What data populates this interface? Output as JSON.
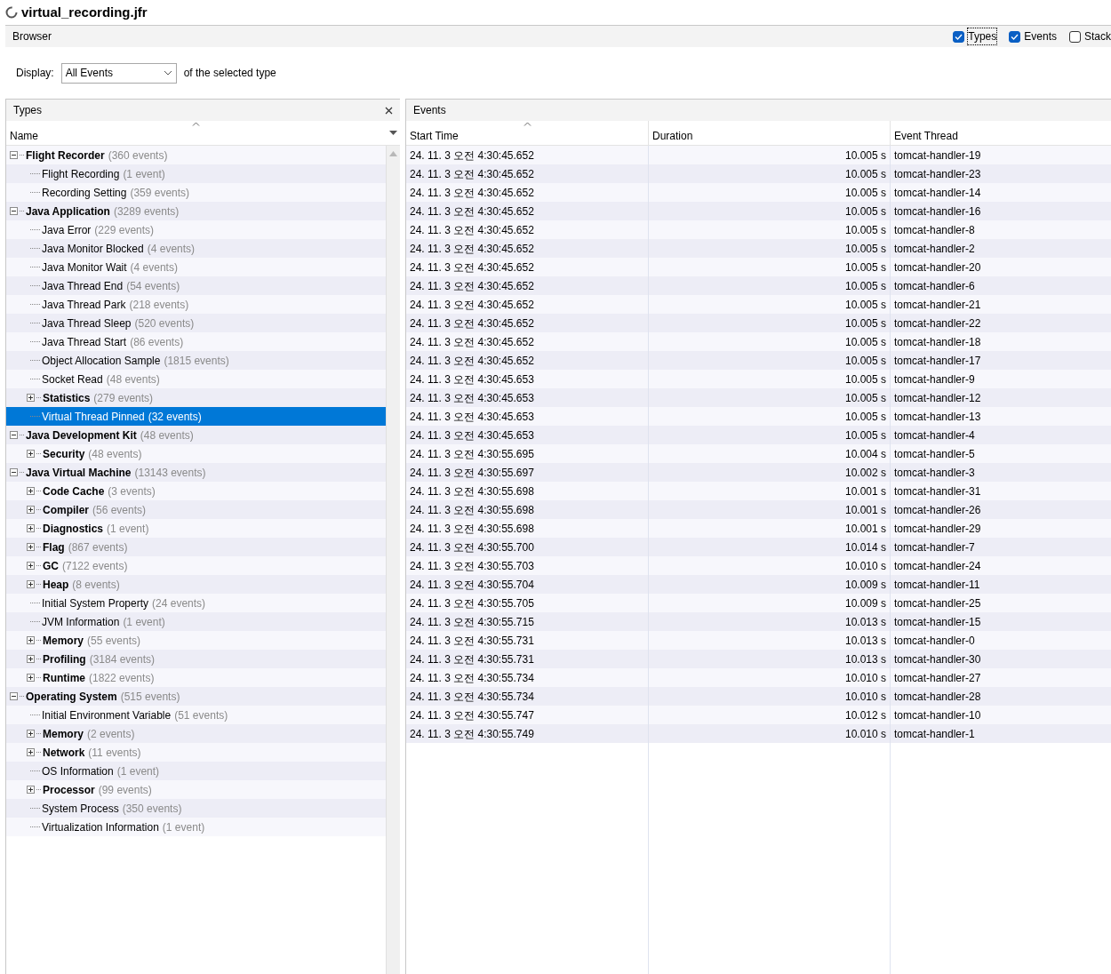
{
  "window": {
    "title": "virtual_recording.jfr"
  },
  "toolbar": {
    "title": "Browser",
    "toggles": [
      {
        "label": "Types",
        "checked": true,
        "focused": true
      },
      {
        "label": "Events",
        "checked": true,
        "focused": false
      },
      {
        "label": "Stack",
        "checked": false,
        "focused": false
      }
    ]
  },
  "display": {
    "label": "Display:",
    "value": "All Events",
    "suffix": "of the selected type"
  },
  "types_panel": {
    "title": "Types",
    "column": "Name",
    "tree": [
      {
        "name": "Flight Recorder",
        "count": "(360 events)",
        "kind": "group",
        "expanded": true,
        "selected": false,
        "children": [
          {
            "name": "Flight Recording",
            "count": "(1 event)",
            "kind": "leaf",
            "selected": false
          },
          {
            "name": "Recording Setting",
            "count": "(359 events)",
            "kind": "leaf",
            "selected": false
          }
        ]
      },
      {
        "name": "Java Application",
        "count": "(3289 events)",
        "kind": "group",
        "expanded": true,
        "selected": false,
        "children": [
          {
            "name": "Java Error",
            "count": "(229 events)",
            "kind": "leaf",
            "selected": false
          },
          {
            "name": "Java Monitor Blocked",
            "count": "(4 events)",
            "kind": "leaf",
            "selected": false
          },
          {
            "name": "Java Monitor Wait",
            "count": "(4 events)",
            "kind": "leaf",
            "selected": false
          },
          {
            "name": "Java Thread End",
            "count": "(54 events)",
            "kind": "leaf",
            "selected": false
          },
          {
            "name": "Java Thread Park",
            "count": "(218 events)",
            "kind": "leaf",
            "selected": false
          },
          {
            "name": "Java Thread Sleep",
            "count": "(520 events)",
            "kind": "leaf",
            "selected": false
          },
          {
            "name": "Java Thread Start",
            "count": "(86 events)",
            "kind": "leaf",
            "selected": false
          },
          {
            "name": "Object Allocation Sample",
            "count": "(1815 events)",
            "kind": "leaf",
            "selected": false
          },
          {
            "name": "Socket Read",
            "count": "(48 events)",
            "kind": "leaf",
            "selected": false
          },
          {
            "name": "Statistics",
            "count": "(279 events)",
            "kind": "group",
            "expanded": false,
            "selected": false
          },
          {
            "name": "Virtual Thread Pinned",
            "count": "(32 events)",
            "kind": "leaf",
            "selected": true
          }
        ]
      },
      {
        "name": "Java Development Kit",
        "count": "(48 events)",
        "kind": "group",
        "expanded": true,
        "selected": false,
        "children": [
          {
            "name": "Security",
            "count": "(48 events)",
            "kind": "group",
            "expanded": false,
            "selected": false
          }
        ]
      },
      {
        "name": "Java Virtual Machine",
        "count": "(13143 events)",
        "kind": "group",
        "expanded": true,
        "selected": false,
        "children": [
          {
            "name": "Code Cache",
            "count": "(3 events)",
            "kind": "group",
            "expanded": false,
            "selected": false
          },
          {
            "name": "Compiler",
            "count": "(56 events)",
            "kind": "group",
            "expanded": false,
            "selected": false
          },
          {
            "name": "Diagnostics",
            "count": "(1 event)",
            "kind": "group",
            "expanded": false,
            "selected": false
          },
          {
            "name": "Flag",
            "count": "(867 events)",
            "kind": "group",
            "expanded": false,
            "selected": false
          },
          {
            "name": "GC",
            "count": "(7122 events)",
            "kind": "group",
            "expanded": false,
            "selected": false
          },
          {
            "name": "Heap",
            "count": "(8 events)",
            "kind": "group",
            "expanded": false,
            "selected": false
          },
          {
            "name": "Initial System Property",
            "count": "(24 events)",
            "kind": "leaf",
            "selected": false
          },
          {
            "name": "JVM Information",
            "count": "(1 event)",
            "kind": "leaf",
            "selected": false
          },
          {
            "name": "Memory",
            "count": "(55 events)",
            "kind": "group",
            "expanded": false,
            "selected": false
          },
          {
            "name": "Profiling",
            "count": "(3184 events)",
            "kind": "group",
            "expanded": false,
            "selected": false
          },
          {
            "name": "Runtime",
            "count": "(1822 events)",
            "kind": "group",
            "expanded": false,
            "selected": false
          }
        ]
      },
      {
        "name": "Operating System",
        "count": "(515 events)",
        "kind": "group",
        "expanded": true,
        "selected": false,
        "children": [
          {
            "name": "Initial Environment Variable",
            "count": "(51 events)",
            "kind": "leaf",
            "selected": false
          },
          {
            "name": "Memory",
            "count": "(2 events)",
            "kind": "group",
            "expanded": false,
            "selected": false
          },
          {
            "name": "Network",
            "count": "(11 events)",
            "kind": "group",
            "expanded": false,
            "selected": false
          },
          {
            "name": "OS Information",
            "count": "(1 event)",
            "kind": "leaf",
            "selected": false
          },
          {
            "name": "Processor",
            "count": "(99 events)",
            "kind": "group",
            "expanded": false,
            "selected": false
          },
          {
            "name": "System Process",
            "count": "(350 events)",
            "kind": "leaf",
            "selected": false
          },
          {
            "name": "Virtualization Information",
            "count": "(1 event)",
            "kind": "leaf",
            "selected": false
          }
        ]
      }
    ]
  },
  "events_panel": {
    "title": "Events",
    "columns": [
      "Start Time",
      "Duration",
      "Event Thread"
    ],
    "rows": [
      [
        "24. 11. 3 오전 4:30:45.652",
        "10.005 s",
        "tomcat-handler-19"
      ],
      [
        "24. 11. 3 오전 4:30:45.652",
        "10.005 s",
        "tomcat-handler-23"
      ],
      [
        "24. 11. 3 오전 4:30:45.652",
        "10.005 s",
        "tomcat-handler-14"
      ],
      [
        "24. 11. 3 오전 4:30:45.652",
        "10.005 s",
        "tomcat-handler-16"
      ],
      [
        "24. 11. 3 오전 4:30:45.652",
        "10.005 s",
        "tomcat-handler-8"
      ],
      [
        "24. 11. 3 오전 4:30:45.652",
        "10.005 s",
        "tomcat-handler-2"
      ],
      [
        "24. 11. 3 오전 4:30:45.652",
        "10.005 s",
        "tomcat-handler-20"
      ],
      [
        "24. 11. 3 오전 4:30:45.652",
        "10.005 s",
        "tomcat-handler-6"
      ],
      [
        "24. 11. 3 오전 4:30:45.652",
        "10.005 s",
        "tomcat-handler-21"
      ],
      [
        "24. 11. 3 오전 4:30:45.652",
        "10.005 s",
        "tomcat-handler-22"
      ],
      [
        "24. 11. 3 오전 4:30:45.652",
        "10.005 s",
        "tomcat-handler-18"
      ],
      [
        "24. 11. 3 오전 4:30:45.652",
        "10.005 s",
        "tomcat-handler-17"
      ],
      [
        "24. 11. 3 오전 4:30:45.653",
        "10.005 s",
        "tomcat-handler-9"
      ],
      [
        "24. 11. 3 오전 4:30:45.653",
        "10.005 s",
        "tomcat-handler-12"
      ],
      [
        "24. 11. 3 오전 4:30:45.653",
        "10.005 s",
        "tomcat-handler-13"
      ],
      [
        "24. 11. 3 오전 4:30:45.653",
        "10.005 s",
        "tomcat-handler-4"
      ],
      [
        "24. 11. 3 오전 4:30:55.695",
        "10.004 s",
        "tomcat-handler-5"
      ],
      [
        "24. 11. 3 오전 4:30:55.697",
        "10.002 s",
        "tomcat-handler-3"
      ],
      [
        "24. 11. 3 오전 4:30:55.698",
        "10.001 s",
        "tomcat-handler-31"
      ],
      [
        "24. 11. 3 오전 4:30:55.698",
        "10.001 s",
        "tomcat-handler-26"
      ],
      [
        "24. 11. 3 오전 4:30:55.698",
        "10.001 s",
        "tomcat-handler-29"
      ],
      [
        "24. 11. 3 오전 4:30:55.700",
        "10.014 s",
        "tomcat-handler-7"
      ],
      [
        "24. 11. 3 오전 4:30:55.703",
        "10.010 s",
        "tomcat-handler-24"
      ],
      [
        "24. 11. 3 오전 4:30:55.704",
        "10.009 s",
        "tomcat-handler-11"
      ],
      [
        "24. 11. 3 오전 4:30:55.705",
        "10.009 s",
        "tomcat-handler-25"
      ],
      [
        "24. 11. 3 오전 4:30:55.715",
        "10.013 s",
        "tomcat-handler-15"
      ],
      [
        "24. 11. 3 오전 4:30:55.731",
        "10.013 s",
        "tomcat-handler-0"
      ],
      [
        "24. 11. 3 오전 4:30:55.731",
        "10.013 s",
        "tomcat-handler-30"
      ],
      [
        "24. 11. 3 오전 4:30:55.734",
        "10.010 s",
        "tomcat-handler-27"
      ],
      [
        "24. 11. 3 오전 4:30:55.734",
        "10.010 s",
        "tomcat-handler-28"
      ],
      [
        "24. 11. 3 오전 4:30:55.747",
        "10.012 s",
        "tomcat-handler-10"
      ],
      [
        "24. 11. 3 오전 4:30:55.749",
        "10.010 s",
        "tomcat-handler-1"
      ]
    ]
  }
}
